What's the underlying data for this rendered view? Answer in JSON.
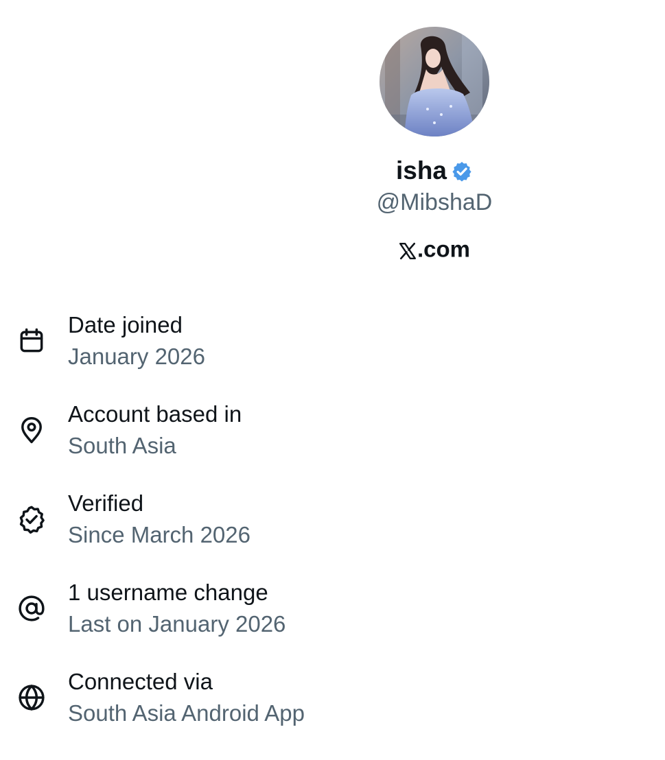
{
  "profile": {
    "display_name": "isha",
    "handle": "@MibshaD",
    "verified": true,
    "site": ".com",
    "badge_color": "#4a99e9"
  },
  "info": [
    {
      "icon": "calendar-icon",
      "label": "Date joined",
      "value": "January 2026"
    },
    {
      "icon": "location-pin-icon",
      "label": "Account based in",
      "value": "South Asia"
    },
    {
      "icon": "verified-check-icon",
      "label": "Verified",
      "value": "Since March 2026"
    },
    {
      "icon": "at-sign-icon",
      "label": "1 username change",
      "value": "Last on January 2026"
    },
    {
      "icon": "globe-icon",
      "label": "Connected via",
      "value": "South Asia Android App"
    }
  ],
  "colors": {
    "text_primary": "#0f1419",
    "text_secondary": "#536471",
    "background": "#ffffff"
  }
}
